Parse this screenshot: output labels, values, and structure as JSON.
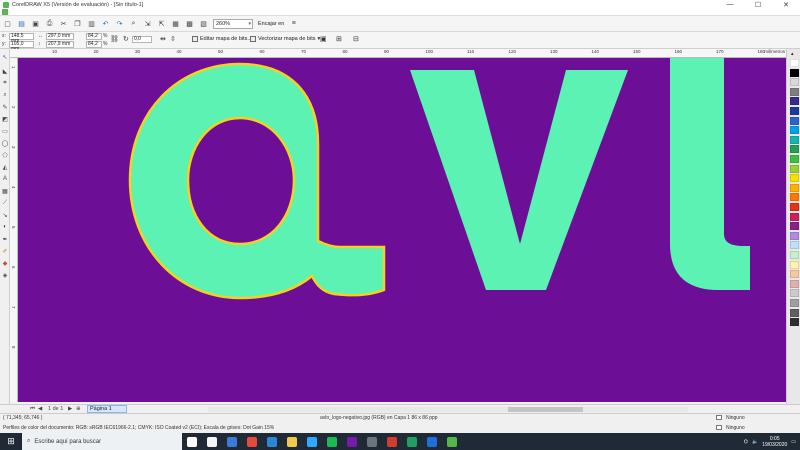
{
  "window": {
    "title": "CorelDRAW X5 (Versión de evaluación) - [Sin título-1]",
    "minimize": "—",
    "maximize": "☐",
    "close": "✕"
  },
  "toolbar": {
    "zoom": "260%",
    "snap_label": "Encajar en"
  },
  "propbar": {
    "x_label": "x:",
    "x": "148,5 mm",
    "y_label": "y:",
    "y": "105,0 mm",
    "w": "297,0 mm",
    "h": "207,9 mm",
    "sx": "84,2",
    "sy": "84,2",
    "sx_unit": "%",
    "sy_unit": "%",
    "angle": "0,0",
    "edit_bitmap": "Editar mapa de bits...",
    "trace_bitmap": "Vectorizar mapa de bits"
  },
  "ruler": {
    "unit": "milímetros",
    "htick_labels": [
      "10",
      "20",
      "30",
      "40",
      "50",
      "60",
      "70",
      "80",
      "90",
      "100",
      "110",
      "120",
      "130",
      "140",
      "150",
      "160",
      "170",
      "180"
    ],
    "vtick_labels": [
      "1",
      "2",
      "3",
      "4",
      "5",
      "6",
      "7",
      "8"
    ]
  },
  "canvas": {
    "background": "#6d0f96",
    "letter_fill": "#5cf2b4",
    "outline": "#f4d11c",
    "logo_text": "avl"
  },
  "palette": {
    "colors": [
      "#ffffff",
      "#000000",
      "#d9d9d9",
      "#7f7f7f",
      "#3a2a8a",
      "#1e3aa0",
      "#2b62d8",
      "#00a2e8",
      "#18b3b3",
      "#22a055",
      "#3fbf3f",
      "#9ccf2f",
      "#f5e100",
      "#ffb000",
      "#ff7800",
      "#e8321b",
      "#cc1f5f",
      "#8b1f8b",
      "#b08be0",
      "#bfe0f5",
      "#c8f0c8",
      "#fff3b0",
      "#f5c8a0",
      "#e0b0b0",
      "#cccccc",
      "#a0a0a0",
      "#606060",
      "#303030"
    ]
  },
  "pagenav": {
    "page_count": "1 de 1",
    "page_tab": "Página 1"
  },
  "status": {
    "coords": "( 71,345; 65,746 )",
    "object_info": "avlo_logo-negativo.jpg (RGB) en Capa 1 86 x 86 ppp",
    "color_profiles": "Perfiles de color del documento: RGB: sRGB IEC61966-2.1; CMYK: ISO Coated v2 (ECI); Escala de grises: Dot Gain 15%",
    "fill_none": "Ninguno",
    "outline_none": "Ninguno"
  },
  "taskbar": {
    "search_placeholder": "Escribe aquí para buscar",
    "time": "0:05",
    "date": "19/03/2020",
    "apps": [
      {
        "name": "task-view",
        "color": "#ffffff"
      },
      {
        "name": "store",
        "color": "#f5f5f5"
      },
      {
        "name": "mail",
        "color": "#3a7bd5"
      },
      {
        "name": "chrome",
        "color": "#e8493a"
      },
      {
        "name": "edge",
        "color": "#2b88d8"
      },
      {
        "name": "explorer",
        "color": "#f2c94c"
      },
      {
        "name": "photoshop",
        "color": "#31a8ff"
      },
      {
        "name": "spotify",
        "color": "#1db954"
      },
      {
        "name": "onenote",
        "color": "#7719aa"
      },
      {
        "name": "app-gray",
        "color": "#6b7580"
      },
      {
        "name": "app-red",
        "color": "#d63b2f"
      },
      {
        "name": "app-green",
        "color": "#20a060"
      },
      {
        "name": "app-blue",
        "color": "#1e6fd9"
      },
      {
        "name": "coreldraw",
        "color": "#54b848"
      }
    ]
  }
}
